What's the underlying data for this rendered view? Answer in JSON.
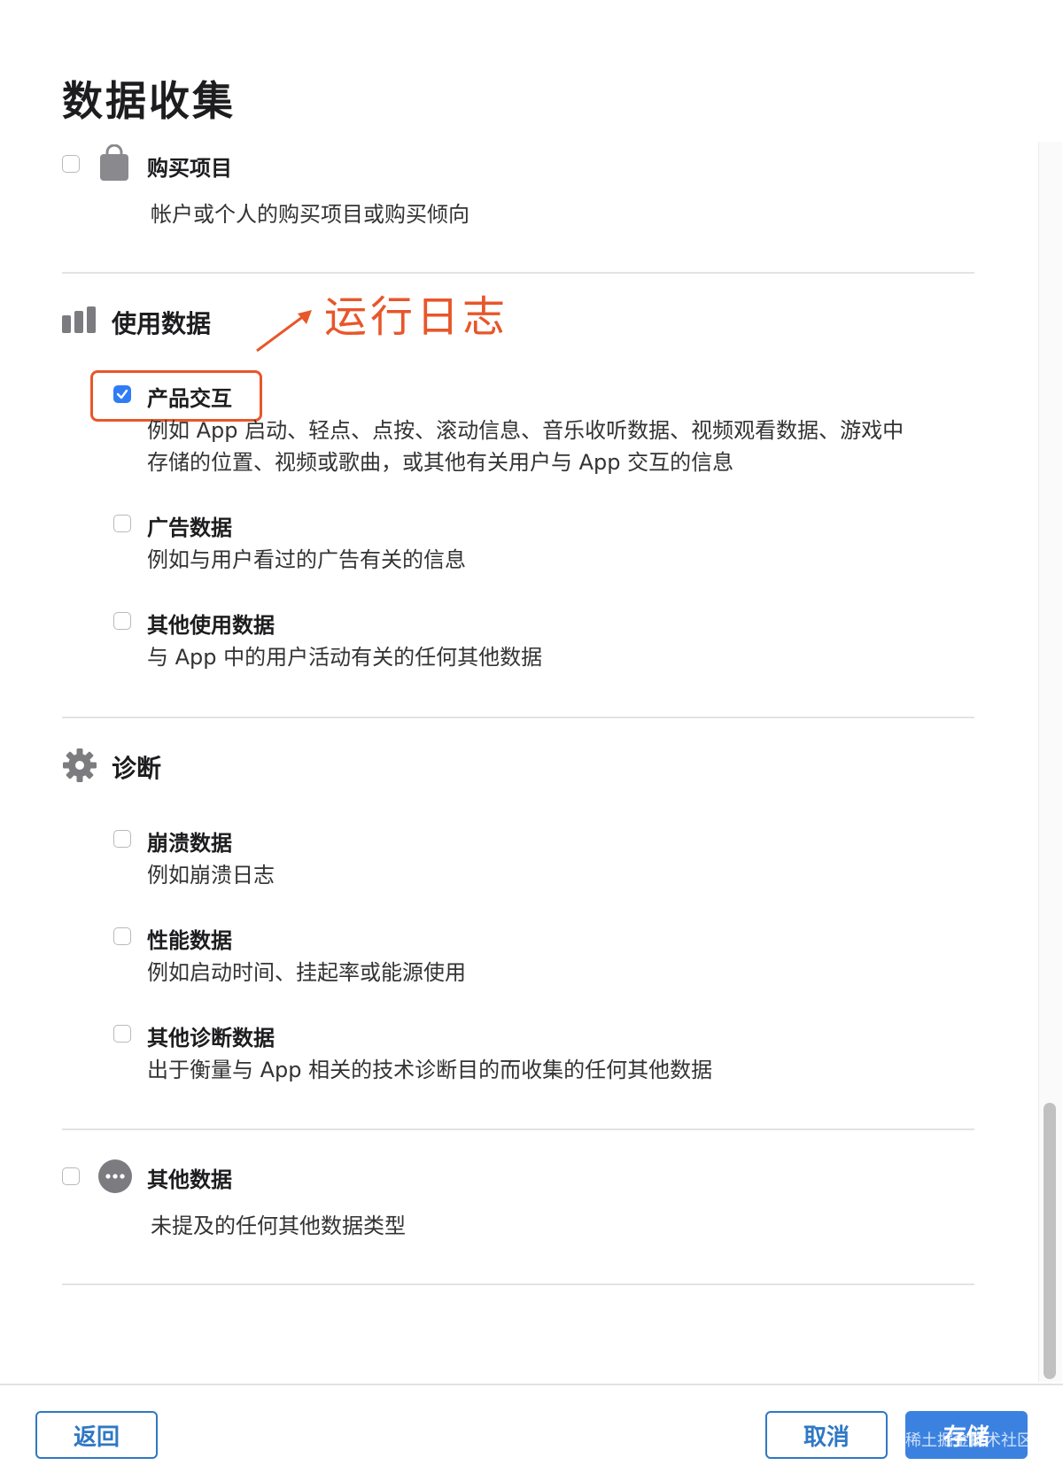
{
  "title": "数据收集",
  "purchase": {
    "label": "购买项目",
    "desc": "帐户或个人的购买项目或购买倾向",
    "checked": false,
    "icon": "shopping-bag-icon"
  },
  "usage_section": {
    "title": "使用数据",
    "icon": "bar-chart-icon",
    "items": [
      {
        "label": "产品交互",
        "desc_line1": "例如 App 启动、轻点、点按、滚动信息、音乐收听数据、视频观看数据、游戏中",
        "desc_line2": "存储的位置、视频或歌曲，或其他有关用户与 App 交互的信息",
        "checked": true
      },
      {
        "label": "广告数据",
        "desc": "例如与用户看过的广告有关的信息",
        "checked": false
      },
      {
        "label": "其他使用数据",
        "desc": "与 App 中的用户活动有关的任何其他数据",
        "checked": false
      }
    ]
  },
  "diagnostics_section": {
    "title": "诊断",
    "icon": "gear-icon",
    "items": [
      {
        "label": "崩溃数据",
        "desc": "例如崩溃日志",
        "checked": false
      },
      {
        "label": "性能数据",
        "desc": "例如启动时间、挂起率或能源使用",
        "checked": false
      },
      {
        "label": "其他诊断数据",
        "desc": "出于衡量与 App 相关的技术诊断目的而收集的任何其他数据",
        "checked": false
      }
    ]
  },
  "other_data": {
    "label": "其他数据",
    "desc": "未提及的任何其他数据类型",
    "checked": false,
    "icon": "ellipsis-circle-icon"
  },
  "annotation": {
    "text": "运行日志",
    "color": "#e8562a"
  },
  "footer": {
    "back_label": "返回",
    "cancel_label": "取消",
    "save_label": "存储"
  },
  "watermark": "@稀土掘金技术社区",
  "colors": {
    "accent": "#2f7cf6",
    "button_border": "#2f78c4",
    "primary_button": "#3b82e0"
  }
}
